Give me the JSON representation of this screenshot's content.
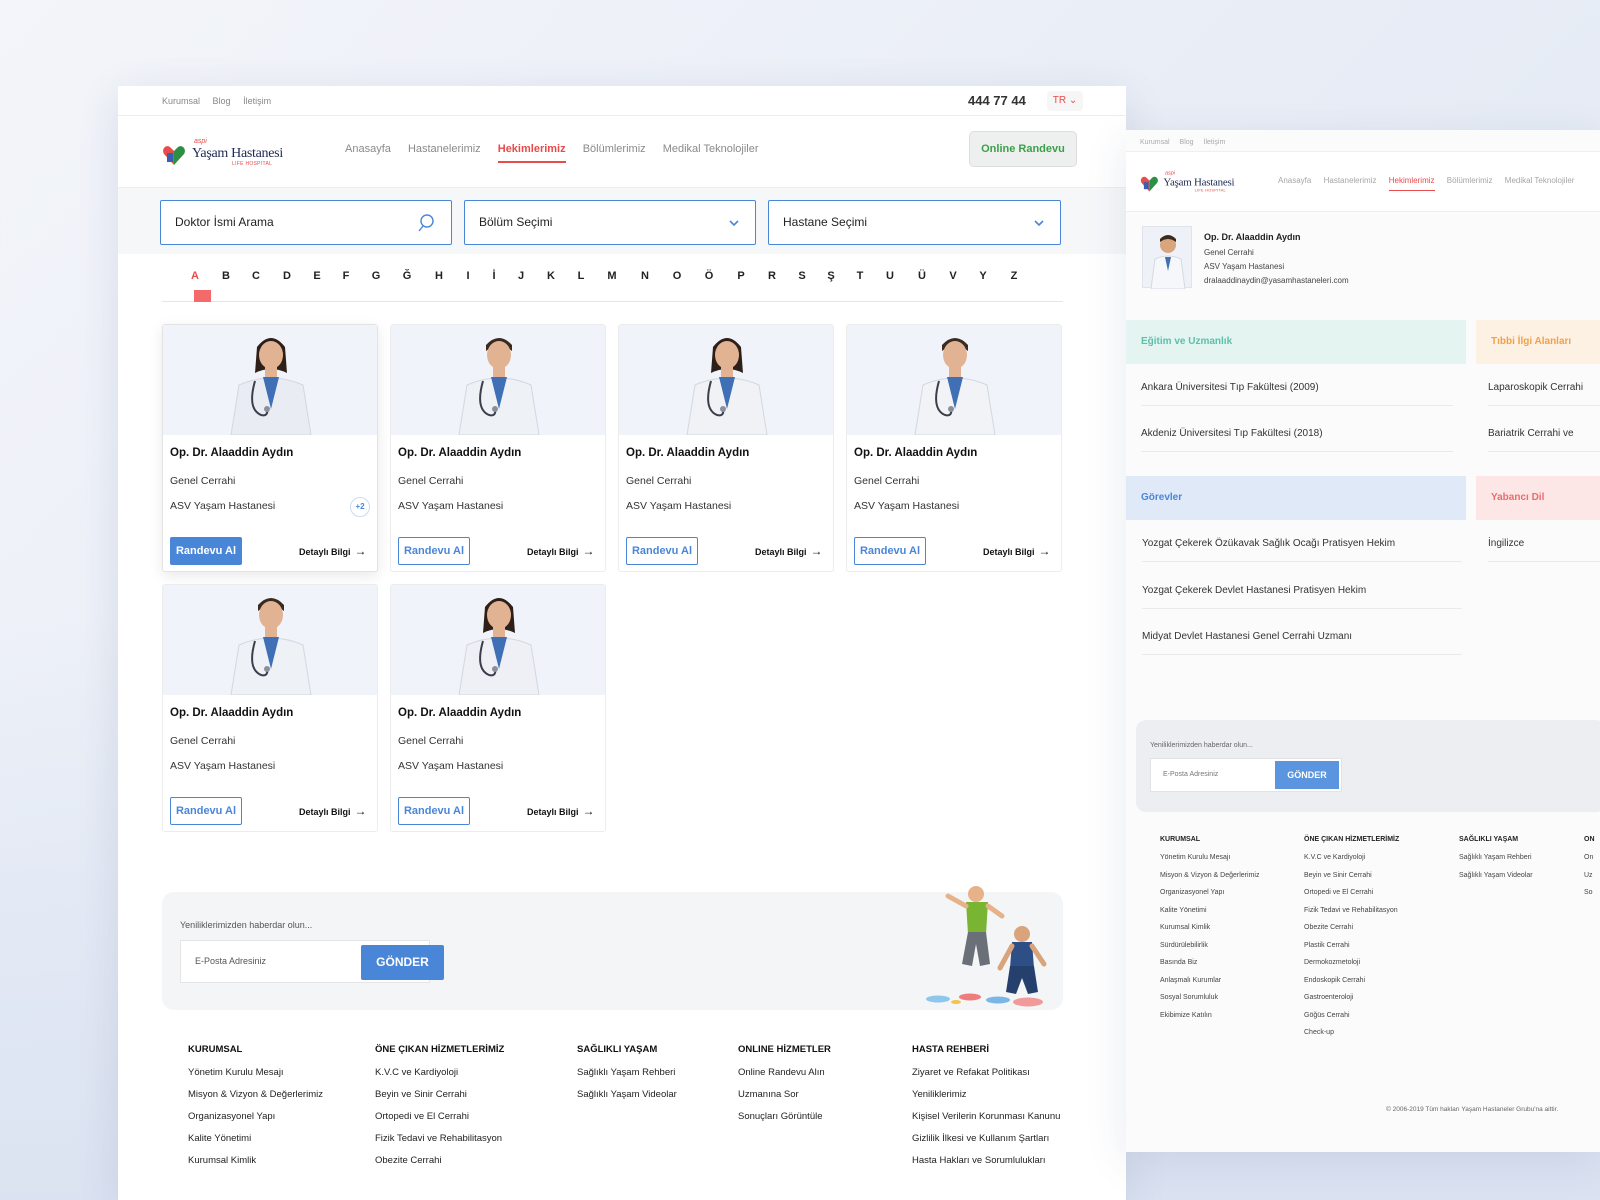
{
  "topbar": {
    "links": [
      "Kurumsal",
      "Blog",
      "İletişim"
    ],
    "phone": "444 77 44",
    "lang": "TR"
  },
  "logo": {
    "tag": "aspi",
    "name": "Yaşam Hastanesi",
    "sub": "LIFE HOSPITAL"
  },
  "nav": {
    "items": [
      "Anasayfa",
      "Hastanelerimiz",
      "Hekimlerimiz",
      "Bölümlerimiz",
      "Medikal Teknolojiler"
    ],
    "active": "Hekimlerimiz",
    "cta": "Online Randevu"
  },
  "filters": {
    "doctor": "Doktor İsmi Arama",
    "department": "Bölüm Seçimi",
    "hospital": "Hastane Seçimi"
  },
  "alphabet": [
    "A",
    "B",
    "C",
    "D",
    "E",
    "F",
    "G",
    "Ğ",
    "H",
    "I",
    "İ",
    "J",
    "K",
    "L",
    "M",
    "N",
    "O",
    "Ö",
    "P",
    "R",
    "S",
    "Ş",
    "T",
    "U",
    "Ü",
    "V",
    "Y",
    "Z"
  ],
  "alphabet_active": "A",
  "doctors": [
    {
      "name": "Op. Dr. Alaaddin Aydın",
      "dept": "Genel Cerrahi",
      "hospital": "ASV Yaşam Hastanesi",
      "extra": "+2",
      "btn": "Randevu Al",
      "detail": "Detaylı Bilgi",
      "gender": "f",
      "coat": "#e9ecf2"
    },
    {
      "name": "Op. Dr. Alaaddin Aydın",
      "dept": "Genel Cerrahi",
      "hospital": "ASV Yaşam Hastanesi",
      "btn": "Randevu Al",
      "detail": "Detaylı Bilgi",
      "gender": "m",
      "coat": "#eef1f6"
    },
    {
      "name": "Op. Dr. Alaaddin Aydın",
      "dept": "Genel Cerrahi",
      "hospital": "ASV Yaşam Hastanesi",
      "btn": "Randevu Al",
      "detail": "Detaylı Bilgi",
      "gender": "f",
      "coat": "#f0f2f6"
    },
    {
      "name": "Op. Dr. Alaaddin Aydın",
      "dept": "Genel Cerrahi",
      "hospital": "ASV Yaşam Hastanesi",
      "btn": "Randevu Al",
      "detail": "Detaylı Bilgi",
      "gender": "m",
      "coat": "#f2f3f6"
    },
    {
      "name": "Op. Dr. Alaaddin Aydın",
      "dept": "Genel Cerrahi",
      "hospital": "ASV Yaşam Hastanesi",
      "btn": "Randevu Al",
      "detail": "Detaylı Bilgi",
      "gender": "m",
      "coat": "#eef1f6"
    },
    {
      "name": "Op. Dr. Alaaddin Aydın",
      "dept": "Genel Cerrahi",
      "hospital": "ASV Yaşam Hastanesi",
      "btn": "Randevu Al",
      "detail": "Detaylı Bilgi",
      "gender": "f",
      "coat": "#eef0f5"
    }
  ],
  "newsletter": {
    "label": "Yeniliklerimizden haberdar olun...",
    "placeholder": "E-Posta Adresiniz",
    "button": "GÖNDER"
  },
  "footer": [
    {
      "title": "KURUMSAL",
      "items": [
        "Yönetim Kurulu Mesajı",
        "Misyon & Vizyon & Değerlerimiz",
        "Organizasyonel Yapı",
        "Kalite Yönetimi",
        "Kurumsal Kimlik"
      ]
    },
    {
      "title": "ÖNE ÇIKAN HİZMETLERİMİZ",
      "items": [
        "K.V.C ve Kardiyoloji",
        "Beyin ve Sinir Cerrahi",
        "Ortopedi ve El Cerrahi",
        "Fizik Tedavi ve Rehabilitasyon",
        "Obezite Cerrahi"
      ]
    },
    {
      "title": "SAĞLIKLI YAŞAM",
      "items": [
        "Sağlıklı Yaşam Rehberi",
        "Sağlıklı Yaşam Videolar"
      ]
    },
    {
      "title": "ONLINE HİZMETLER",
      "items": [
        "Online Randevu Alın",
        "Uzmanına Sor",
        "Sonuçları Görüntüle"
      ]
    },
    {
      "title": "HASTA REHBERİ",
      "items": [
        "Ziyaret ve Refakat Politikası",
        "Yeniliklerimiz",
        "Kişisel Verilerin Korunması Kanunu",
        "Gizlilik İlkesi ve Kullanım Şartları",
        "Hasta Hakları ve Sorumlulukları"
      ]
    }
  ],
  "side": {
    "topbar": [
      "Kurumsal",
      "Blog",
      "İletişim"
    ],
    "nav": [
      "Anasayfa",
      "Hastanelerimiz",
      "Hekimlerimiz",
      "Bölümlerimiz",
      "Medikal Teknolojiler"
    ],
    "profile": {
      "name": "Op. Dr. Alaaddin Aydın",
      "dept": "Genel Cerrahi",
      "hospital": "ASV Yaşam Hastanesi",
      "email": "dralaaddinaydin@yasamhastaneleri.com"
    },
    "education": {
      "title": "Eğitim ve Uzmanlık",
      "items": [
        "Ankara Üniversitesi Tıp Fakültesi (2009)",
        "Akdeniz Üniversitesi Tıp Fakültesi (2018)"
      ]
    },
    "interests": {
      "title": "Tıbbi İlgi Alanları",
      "items": [
        "Laparoskopik Cerrahi",
        "Bariatrik Cerrahi ve"
      ]
    },
    "duties": {
      "title": "Görevler",
      "items": [
        "Yozgat Çekerek Özükavak Sağlık Ocağı Pratisyen Hekim",
        "Yozgat Çekerek Devlet Hastanesi Pratisyen Hekim",
        "Midyat Devlet Hastanesi Genel Cerrahi Uzmanı"
      ]
    },
    "languages": {
      "title": "Yabancı Dil",
      "items": [
        "İngilizce"
      ]
    },
    "newsletter": {
      "label": "Yeniliklerimizden haberdar olun...",
      "placeholder": "E-Posta Adresiniz",
      "button": "GÖNDER"
    },
    "footer": [
      {
        "title": "KURUMSAL",
        "items": [
          "Yönetim Kurulu Mesajı",
          "Misyon & Vizyon & Değerlerimiz",
          "Organizasyonel Yapı",
          "Kalite Yönetimi",
          "Kurumsal Kimlik",
          "Sürdürülebilirlik",
          "Basında Biz",
          "Anlaşmalı Kurumlar",
          "Sosyal Sorumluluk",
          "Ekibimize Katılın"
        ]
      },
      {
        "title": "ÖNE ÇIKAN HİZMETLERİMİZ",
        "items": [
          "K.V.C ve Kardiyoloji",
          "Beyin ve Sinir Cerrahi",
          "Ortopedi ve El Cerrahi",
          "Fizik Tedavi ve Rehabilitasyon",
          "Obezite Cerrahi",
          "Plastik Cerrahi",
          "Dermokozmetoloji",
          "Endoskopik Cerrahi",
          "Gastroenteroloji",
          "Göğüs Cerrahi",
          "Check-up"
        ]
      },
      {
        "title": "SAĞLIKLI YAŞAM",
        "items": [
          "Sağlıklı Yaşam Rehberi",
          "Sağlıklı Yaşam Videolar"
        ]
      },
      {
        "title": "ON",
        "items": [
          "On",
          "Uz",
          "So"
        ]
      }
    ],
    "copyright": "© 2006-2019 Tüm hakları Yaşam Hastaneler Grubu'na aittir."
  },
  "colors": {
    "accent": "#e84b4b",
    "primary": "#4a86d8",
    "green": "#3aa14a"
  }
}
